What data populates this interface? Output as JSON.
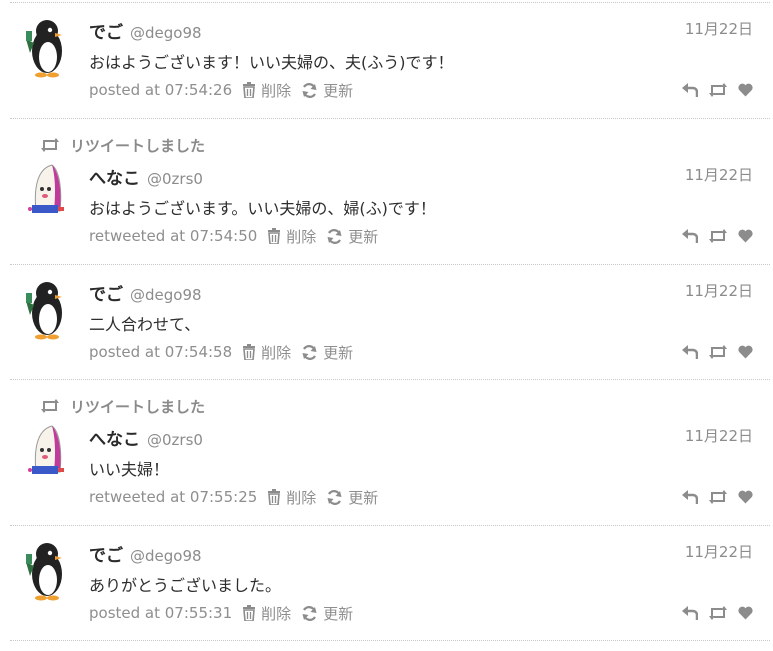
{
  "retweet_banner": "リツイートしました",
  "actions": {
    "delete": "削除",
    "update": "更新"
  },
  "icons": {
    "reply": "reply-icon",
    "retweet": "retweet-icon",
    "like": "heart-icon",
    "trash": "trash-icon",
    "refresh": "refresh-icon"
  },
  "colors": {
    "icon": "#8c8c8c",
    "text": "#333333",
    "separator": "#c9c9c9"
  },
  "tweets": [
    {
      "retweet": false,
      "avatar": "penguin",
      "name": "でご",
      "handle": "@dego98",
      "date": "11月22日",
      "text": "おはようございます！いい夫婦の、夫(ふう)です！",
      "posted": "posted at 07:54:26"
    },
    {
      "retweet": true,
      "avatar": "radish",
      "name": "へなこ",
      "handle": "@0zrs0",
      "date": "11月22日",
      "text": "おはようございます。いい夫婦の、婦(ふ)です！",
      "posted": "retweeted at 07:54:50"
    },
    {
      "retweet": false,
      "avatar": "penguin",
      "name": "でご",
      "handle": "@dego98",
      "date": "11月22日",
      "text": "二人合わせて、",
      "posted": "posted at 07:54:58"
    },
    {
      "retweet": true,
      "avatar": "radish",
      "name": "へなこ",
      "handle": "@0zrs0",
      "date": "11月22日",
      "text": "いい夫婦！",
      "posted": "retweeted at 07:55:25"
    },
    {
      "retweet": false,
      "avatar": "penguin",
      "name": "でご",
      "handle": "@dego98",
      "date": "11月22日",
      "text": "ありがとうございました。",
      "posted": "posted at 07:55:31"
    }
  ]
}
